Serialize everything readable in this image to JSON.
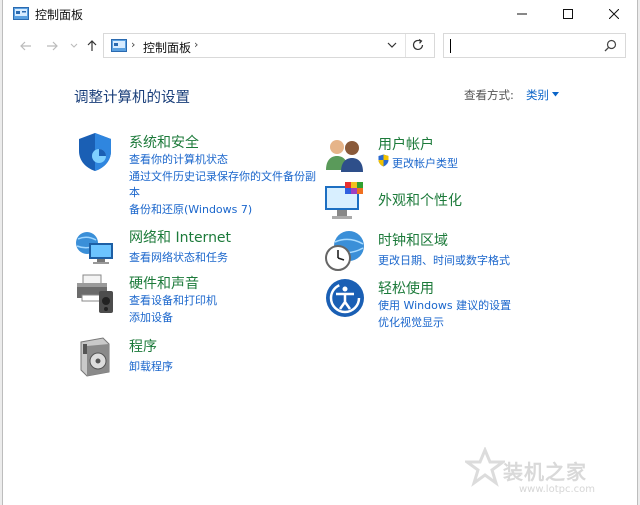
{
  "window": {
    "title": "控制面板"
  },
  "address": {
    "crumb": "控制面板",
    "search_placeholder": ""
  },
  "header": {
    "title": "调整计算机的设置",
    "view_by_label": "查看方式:",
    "view_by_value": "类别"
  },
  "categories": {
    "system_security": {
      "title": "系统和安全",
      "links": [
        "查看你的计算机状态",
        "通过文件历史记录保存你的文件备份副",
        "本",
        "备份和还原(Windows 7)"
      ]
    },
    "network": {
      "title": "网络和 Internet",
      "links": [
        "查看网络状态和任务"
      ]
    },
    "hardware": {
      "title": "硬件和声音",
      "links": [
        "查看设备和打印机",
        "添加设备"
      ]
    },
    "programs": {
      "title": "程序",
      "links": [
        "卸载程序"
      ]
    },
    "user_accounts": {
      "title": "用户帐户",
      "links": [
        "更改帐户类型"
      ]
    },
    "appearance": {
      "title": "外观和个性化",
      "links": []
    },
    "clock_region": {
      "title": "时钟和区域",
      "links": [
        "更改日期、时间或数字格式"
      ]
    },
    "ease_access": {
      "title": "轻松使用",
      "links": [
        "使用 Windows 建议的设置",
        "优化视觉显示"
      ]
    }
  },
  "watermark": {
    "text": "装机之家",
    "url": "www.lotpc.com"
  },
  "colors": {
    "link": "#1a66cc",
    "heading": "#1c7a3a",
    "title": "#1a3f7a"
  }
}
